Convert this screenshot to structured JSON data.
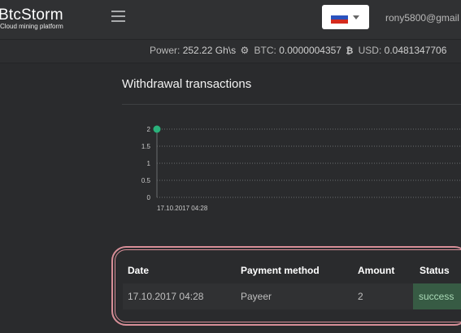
{
  "header": {
    "logo_name": "BtcStorm",
    "logo_sub": "Cloud mining platform",
    "user": "rony5800@gmail"
  },
  "stats": {
    "power_label": "Power:",
    "power_value": "252.22 Gh\\s",
    "btc_label": "BTC:",
    "btc_value": "0.0000004357",
    "usd_label": "USD:",
    "usd_value": "0.0481347706"
  },
  "page": {
    "title": "Withdrawal transactions"
  },
  "chart_data": {
    "type": "line",
    "x": [
      "17.10.2017 04:28"
    ],
    "series": [
      {
        "values": [
          2
        ]
      }
    ],
    "yticks": [
      "2",
      "1.5",
      "1",
      "0.5",
      "0"
    ],
    "ylim": [
      0,
      2
    ],
    "grid": true,
    "color": "#2ab27b"
  },
  "table": {
    "headers": [
      "Date",
      "Payment method",
      "Amount",
      "Status"
    ],
    "rows": [
      {
        "date": "17.10.2017 04:28",
        "method": "Payeer",
        "amount": "2",
        "status": "success"
      }
    ]
  }
}
